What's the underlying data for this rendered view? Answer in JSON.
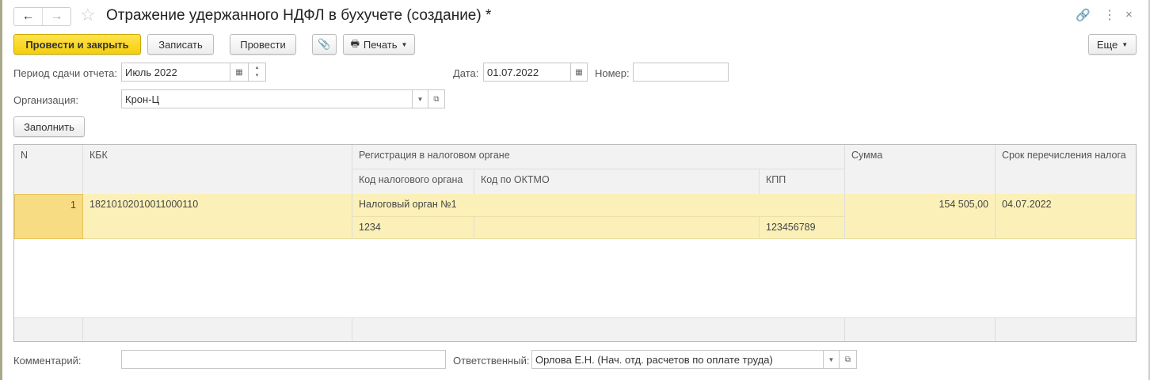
{
  "window": {
    "title": "Отражение удержанного НДФЛ в бухучете (создание) *"
  },
  "toolbar": {
    "post_close": "Провести и закрыть",
    "save": "Записать",
    "post": "Провести",
    "print": "Печать",
    "more": "Еще"
  },
  "form": {
    "period_label": "Период сдачи отчета:",
    "period_value": "Июль 2022",
    "date_label": "Дата:",
    "date_value": "01.07.2022",
    "number_label": "Номер:",
    "number_value": "",
    "org_label": "Организация:",
    "org_value": "Крон-Ц",
    "fill_button": "Заполнить",
    "comment_label": "Комментарий:",
    "comment_value": "",
    "responsible_label": "Ответственный:",
    "responsible_value": "Орлова Е.Н. (Нач. отд. расчетов по оплате труда)"
  },
  "table": {
    "headers": {
      "n": "N",
      "kbk": "КБК",
      "registration": "Регистрация в налоговом органе",
      "tax_code": "Код налогового органа",
      "oktmo": "Код по ОКТМО",
      "kpp": "КПП",
      "sum": "Сумма",
      "deadline": "Срок перечисления налога"
    },
    "rows": [
      {
        "n": "1",
        "kbk": "18210102010011000110",
        "tax_authority": "Налоговый орган №1",
        "tax_code": "1234",
        "oktmo": "",
        "kpp": "123456789",
        "sum": "154 505,00",
        "deadline": "04.07.2022"
      }
    ]
  }
}
